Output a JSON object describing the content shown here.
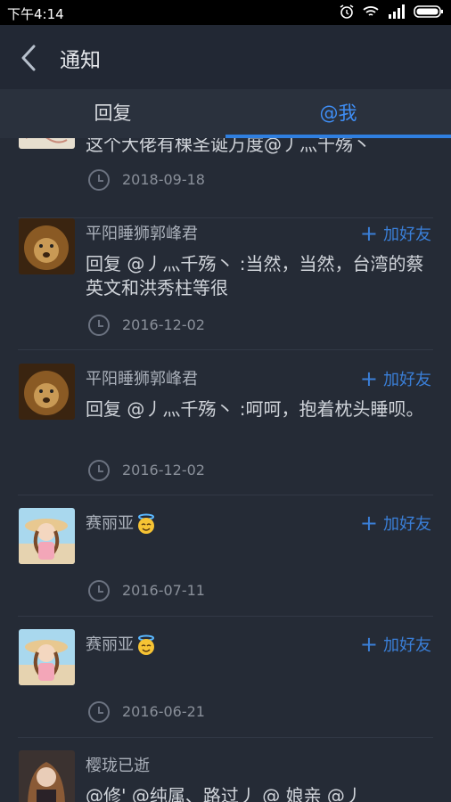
{
  "status_bar": {
    "time": "下午4:14"
  },
  "header": {
    "title": "通知"
  },
  "tabs": [
    {
      "label": "回复",
      "active": false
    },
    {
      "label": "@我",
      "active": true
    }
  ],
  "add_friend_label": "加好友",
  "items": [
    {
      "username": "",
      "content": "这个大佬有棵圣诞万度@丿灬千殇丶",
      "date": "2018-09-18"
    },
    {
      "username": "平阳睡狮郭峰君",
      "content": "回复 @丿灬千殇丶 :当然，当然，台湾的蔡英文和洪秀柱等很",
      "date": "2016-12-02"
    },
    {
      "username": "平阳睡狮郭峰君",
      "content": "回复 @丿灬千殇丶 :呵呵，抱着枕头睡呗。",
      "date": "2016-12-02"
    },
    {
      "username": "赛丽亚",
      "content": "",
      "date": "2016-07-11"
    },
    {
      "username": "赛丽亚",
      "content": "",
      "date": "2016-06-21"
    },
    {
      "username": "樱珑已逝",
      "content": "@修' @纯属、路过丿 @ 娘亲 @丿",
      "date": ""
    }
  ],
  "colors": {
    "accent": "#2f7fe0",
    "background": "#252b36"
  }
}
